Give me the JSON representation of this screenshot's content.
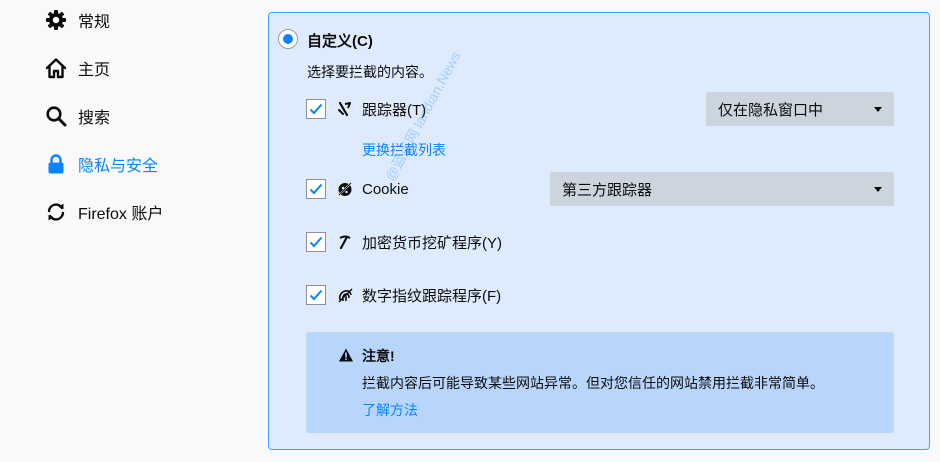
{
  "sidebar": {
    "items": [
      {
        "label": "常规",
        "icon": "gear-icon"
      },
      {
        "label": "主页",
        "icon": "home-icon"
      },
      {
        "label": "搜索",
        "icon": "search-icon"
      },
      {
        "label": "隐私与安全",
        "icon": "lock-icon",
        "active": true
      },
      {
        "label": "Firefox 账户",
        "icon": "sync-icon"
      }
    ]
  },
  "panel": {
    "radio_label": "自定义(C)",
    "description": "选择要拦截的内容。",
    "rows": [
      {
        "label": "跟踪器(T)",
        "checked": true,
        "icon": "tracker-icon"
      },
      {
        "label": "Cookie",
        "checked": true,
        "icon": "cookie-icon"
      },
      {
        "label": "加密货币挖矿程序(Y)",
        "checked": true,
        "icon": "cryptominer-icon"
      },
      {
        "label": "数字指纹跟踪程序(F)",
        "checked": true,
        "icon": "fingerprint-icon"
      }
    ],
    "tracker_dropdown": "仅在隐私窗口中",
    "change_list_link": "更换拦截列表",
    "cookie_dropdown": "第三方跟踪器",
    "warning": {
      "title": "注意!",
      "text": "拦截内容后可能导致某些网站异常。但对您信任的网站禁用拦截非常简单。",
      "link": "了解方法"
    }
  },
  "watermark": "@蓝点网 landian.News",
  "colors": {
    "accent": "#0a84ff",
    "panel_bg": "#deebff",
    "panel_border": "#45a1ff",
    "warning_bg": "#b8d6fb",
    "dropdown_bg": "#ccd4de"
  }
}
